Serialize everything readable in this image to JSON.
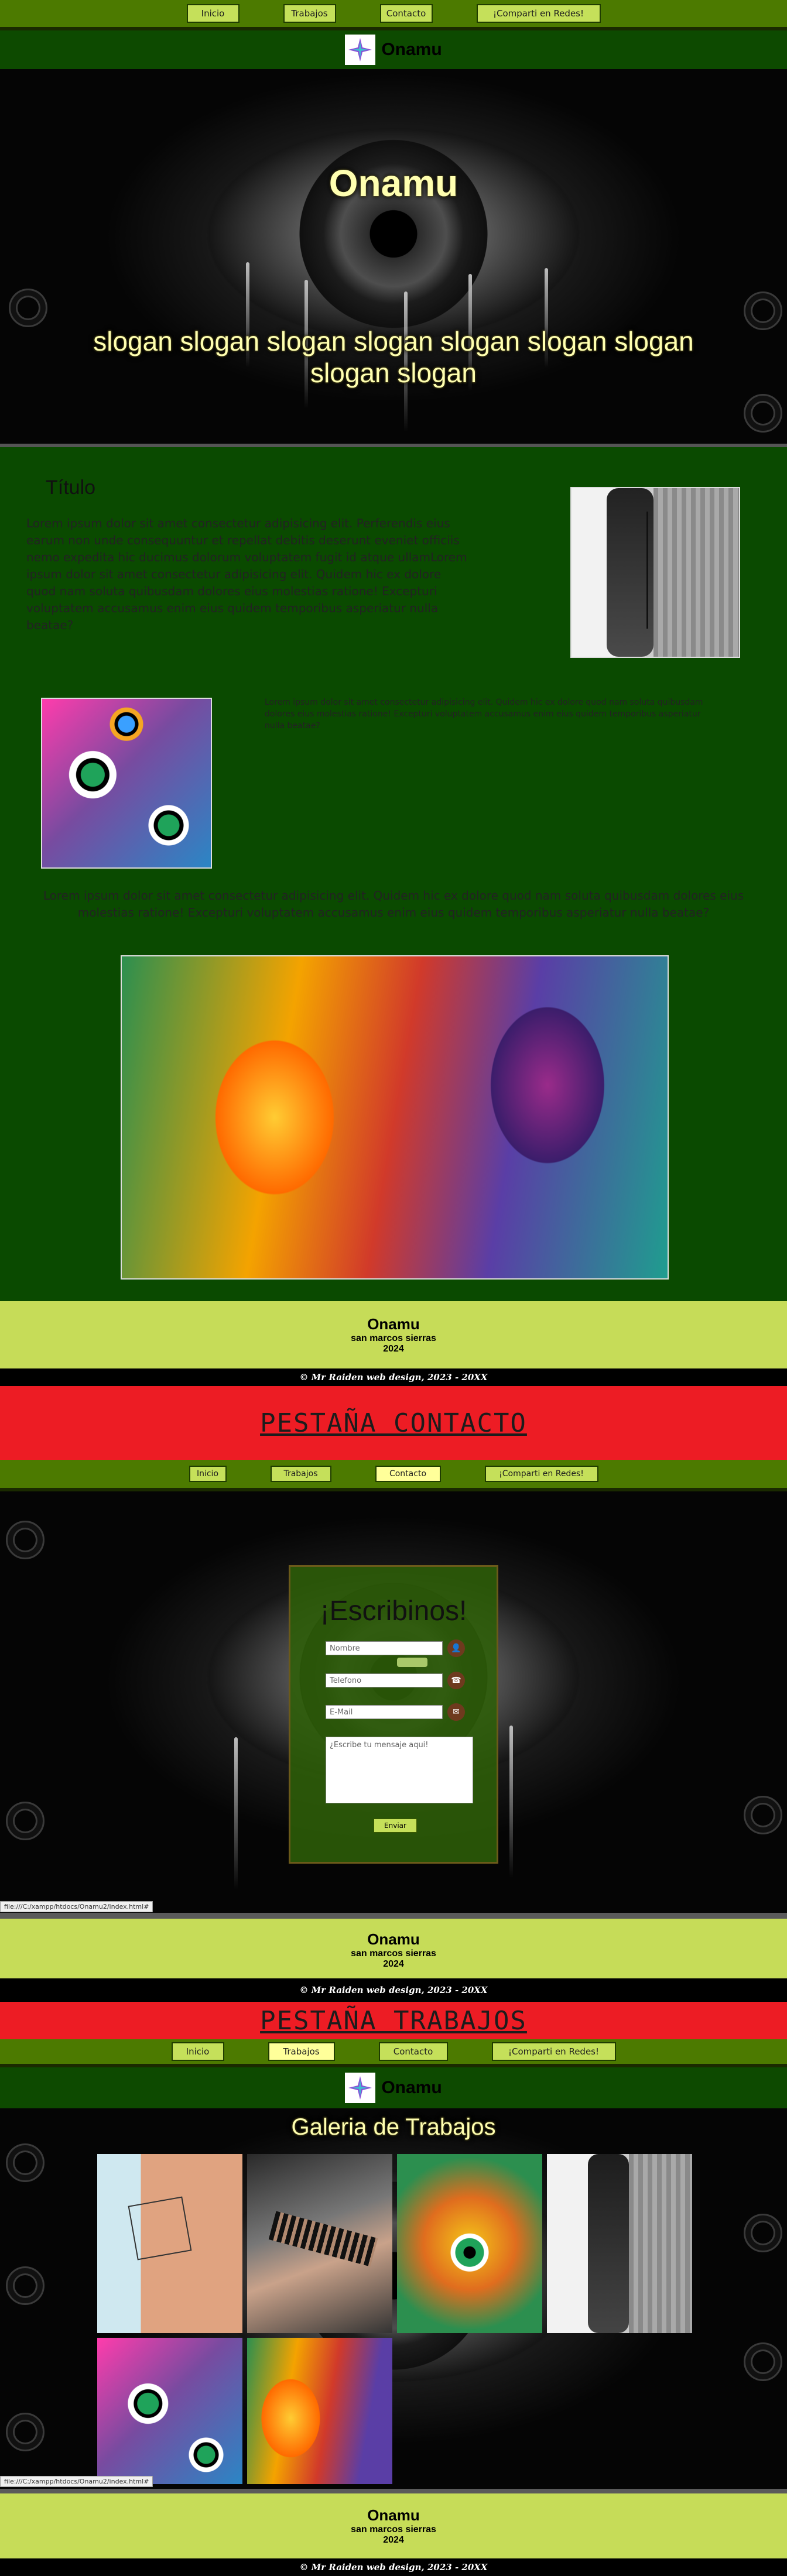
{
  "nav": {
    "items": [
      "Inicio",
      "Trabajos",
      "Contacto",
      "¡Comparti en Redes!"
    ]
  },
  "brand": {
    "name": "Onamu"
  },
  "hero": {
    "title": "Onamu",
    "slogan_line1": "slogan slogan slogan slogan slogan slogan slogan",
    "slogan_line2": "slogan slogan"
  },
  "section1": {
    "title": "Título",
    "text": "Lorem ipsum dolor sit amet consectetur adipisicing elit. Perferendis eius earum non unde consequuntur et repellat debitis deserunt eveniet officiis nemo expedita hic ducimus dolorum voluptatem fugit id atque ullamLorem ipsum dolor sit amet consectetur adipisicing elit. Quidem hic ex dolore quod nam soluta quibusdam dolores eius molestias ratione! Excepturi voluptatem accusamus enim eius quidem temporibus asperiatur nulla beatae?"
  },
  "section2": {
    "text": "Lorem ipsum dolor sit amet consectetur adipisicing elit. Quidem hic ex dolore quod nam soluta quibusdam dolores eius molestias ratione! Excepturi voluptatem accusamus enim eius quidem temporibus asperiatur nulla beatae?"
  },
  "section3": {
    "text": "Lorem ipsum dolor sit amet consectetur adipisicing elit. Quidem hic ex dolore quod nam soluta quibusdam dolores eius molestias ratione! Excepturi voluptatem accusamus enim eius quidem temporibus asperiatur nulla beatae?"
  },
  "footer": {
    "name": "Onamu",
    "city": "san marcos sierras",
    "year": "2024",
    "credit": "© Mr Raiden web design, 2023 - 20XX"
  },
  "contact_tab": {
    "banner": "PESTAÑA CONTACTO",
    "form_title": "¡Escribinos!",
    "name_placeholder": "Nombre",
    "phone_placeholder": "Telefono",
    "email_placeholder": "E-Mail",
    "message_placeholder": "¿Escribe tu mensaje aqui!",
    "send_label": "Enviar",
    "url": "file:///C:/xampp/htdocs/Onamu2/index.html#"
  },
  "works_tab": {
    "banner": "PESTAÑA TRABAJOS",
    "gallery_title": "Galeria de Trabajos",
    "url": "file:///C:/xampp/htdocs/Onamu2/index.html#"
  },
  "colors": {
    "nav_bg": "#4c7a00",
    "button_bg": "#c5e05a",
    "active_button": "#ffff9a",
    "section_green": "#0a4a00",
    "footer_lime": "#c6dc58",
    "banner_red": "#ed1c24"
  },
  "icons": [
    "star-logo-icon",
    "user-icon",
    "phone-icon",
    "mail-icon"
  ]
}
